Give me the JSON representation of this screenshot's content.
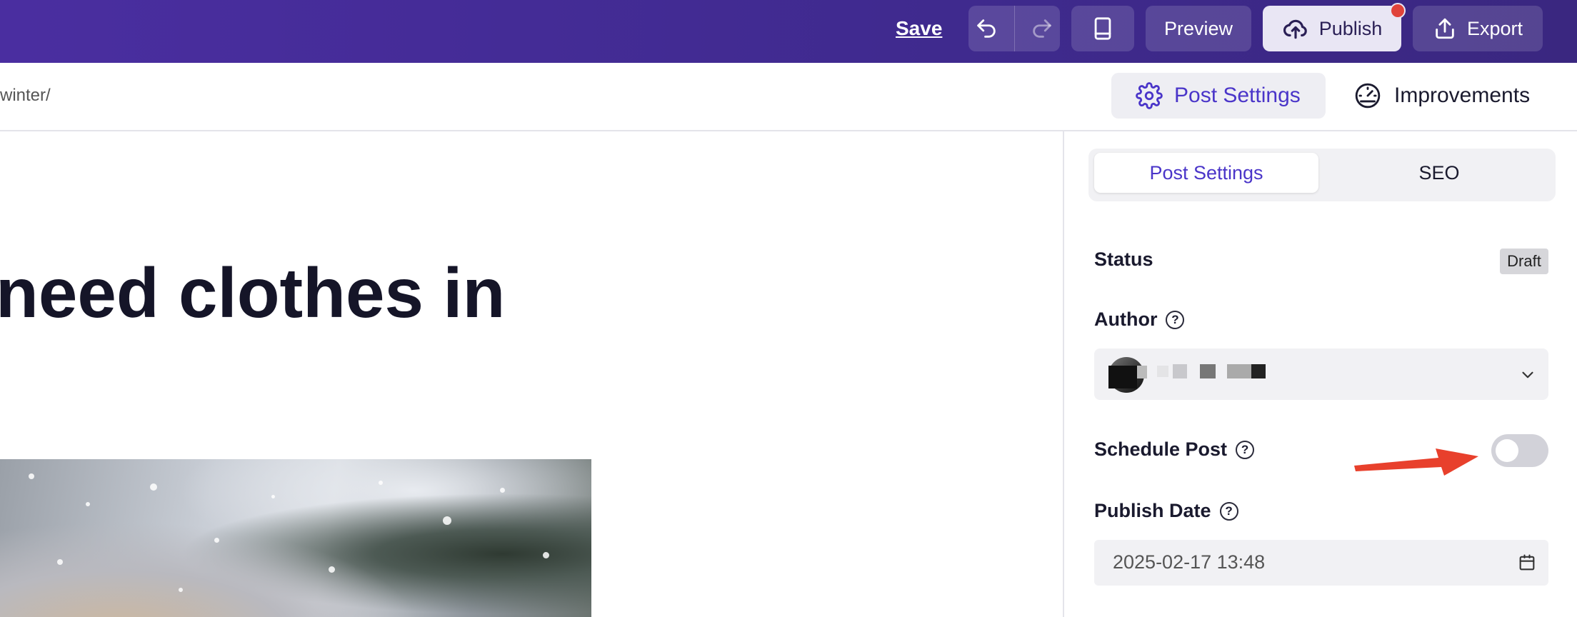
{
  "toolbar": {
    "save_label": "Save",
    "preview_label": "Preview",
    "publish_label": "Publish",
    "export_label": "Export",
    "icons": [
      "undo-icon",
      "redo-icon",
      "device-preview-icon",
      "cloud-upload-icon",
      "export-icon"
    ],
    "accent": "#4a2ea0"
  },
  "subheader": {
    "slug": "winter/",
    "post_settings_label": "Post Settings",
    "improvements_label": "Improvements"
  },
  "canvas": {
    "title": "need clothes in"
  },
  "panel": {
    "tabs": [
      {
        "label": "Post Settings",
        "active": true
      },
      {
        "label": "SEO",
        "active": false
      }
    ],
    "status_label": "Status",
    "status_value": "Draft",
    "author_label": "Author",
    "schedule_label": "Schedule Post",
    "schedule_enabled": false,
    "publish_date_label": "Publish Date",
    "publish_date_value": "2025-02-17 13:48",
    "help_glyph": "?"
  },
  "colors": {
    "brand": "#4a35c9",
    "badge": "#d6d6da",
    "notification": "#e0433a",
    "arrow": "#e8402c"
  }
}
